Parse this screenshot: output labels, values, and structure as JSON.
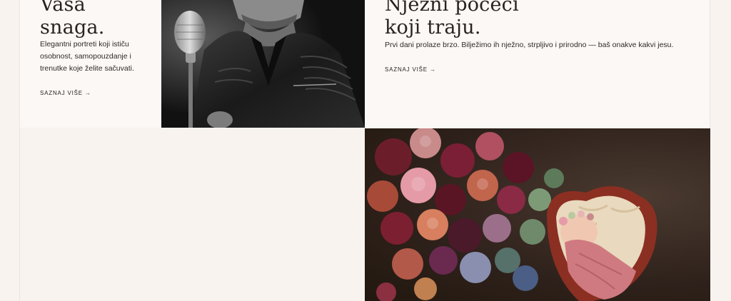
{
  "cards": {
    "portrait": {
      "headline_line1": "Vaša",
      "headline_line2": "snaga.",
      "description": "Elegantni portreti koji ističu osobnost, samopouzdanje i trenutke koje želite sačuvati.",
      "link_label": "SAZNAJ VIŠE",
      "link_arrow": "→"
    },
    "newborn": {
      "headline_line1": "Nježni počeci",
      "headline_line2": "koji traju.",
      "description": "Prvi dani prolaze brzo. Bilježimo ih nježno, strpljivo i prirodno — baš onakve kakvi jesu.",
      "link_label": "SAZNAJ VIŠE",
      "link_arrow": "→"
    }
  },
  "images": {
    "singer_photo": "black-and-white portrait of man with vintage microphone",
    "newborn_photo": "newborn baby in heart-shaped basket with flowers"
  },
  "colors": {
    "background": "#f8f3ee",
    "card_background": "#fbf8f5",
    "text": "#2a2320"
  }
}
